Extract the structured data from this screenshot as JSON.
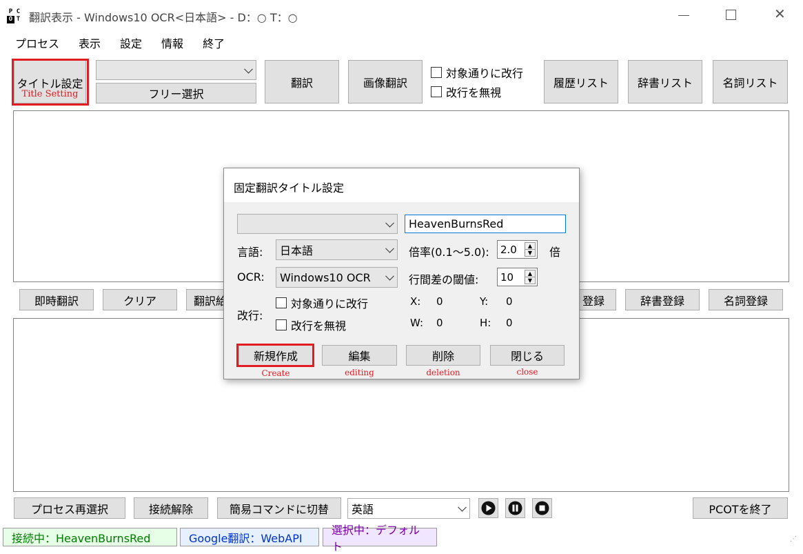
{
  "window": {
    "title": "翻訳表示 - Windows10 OCR<日本語> - D：○ T：○",
    "logo_text": "PCOT"
  },
  "menu": [
    "プロセス",
    "表示",
    "設定",
    "情報",
    "終了"
  ],
  "toolbar": {
    "title_setting_label": "タイトル設定",
    "title_setting_caption": "Title Setting",
    "combo_value": "",
    "free_select_label": "フリー選択",
    "translate_label": "翻訳",
    "image_translate_label": "画像翻訳",
    "chk_linebreak_target": "対象通りに改行",
    "chk_ignore_linebreak": "改行を無視",
    "history_label": "履歴リスト",
    "dictionary_list_label": "辞書リスト",
    "noun_list_label": "名詞リスト"
  },
  "midbar": {
    "instant_translate_label": "即時翻訳",
    "clear_label": "クリア",
    "partial_label": "翻訳給",
    "register_partial_label": "登録",
    "dictionary_register_label": "辞書登録",
    "noun_register_label": "名詞登録"
  },
  "bottombar": {
    "reselect_process_label": "プロセス再選択",
    "disconnect_label": "接続解除",
    "simple_command_label": "簡易コマンドに切替",
    "language_value": "英語",
    "exit_label": "PCOTを終了"
  },
  "statusbar": {
    "connection": "接続中：HeavenBurnsRed",
    "translator": "Google翻訳：WebAPI",
    "selection": "選択中：デフォルト"
  },
  "dialog": {
    "title": "固定翻訳タイトル設定",
    "preset_value": "",
    "title_input_value": "HeavenBurnsRed",
    "language_label": "言語:",
    "language_value": "日本語",
    "scale_label": "倍率(0.1～5.0):",
    "scale_value": "2.0",
    "scale_unit": "倍",
    "ocr_label": "OCR:",
    "ocr_value": "Windows10 OCR",
    "line_gap_label": "行間差の閾値:",
    "line_gap_value": "10",
    "linebreak_label": "改行:",
    "chk_linebreak_target": "対象通りに改行",
    "chk_ignore_linebreak": "改行を無視",
    "x_label": "X:",
    "x_value": "0",
    "y_label": "Y:",
    "y_value": "0",
    "w_label": "W:",
    "w_value": "0",
    "h_label": "H:",
    "h_value": "0",
    "new_label": "新規作成",
    "new_caption": "Create",
    "edit_label": "編集",
    "edit_caption": "editing",
    "delete_label": "削除",
    "delete_caption": "deletion",
    "close_label": "閉じる",
    "close_caption": "close"
  },
  "colors": {
    "highlight": "#e31b23",
    "status_connection_bg": "#e6ffe6",
    "status_connection_fg": "#007a00",
    "status_translator_bg": "#e6f0ff",
    "status_translator_fg": "#0033cc",
    "status_selection_bg": "#f0e6ff",
    "status_selection_fg": "#7a00a8"
  }
}
